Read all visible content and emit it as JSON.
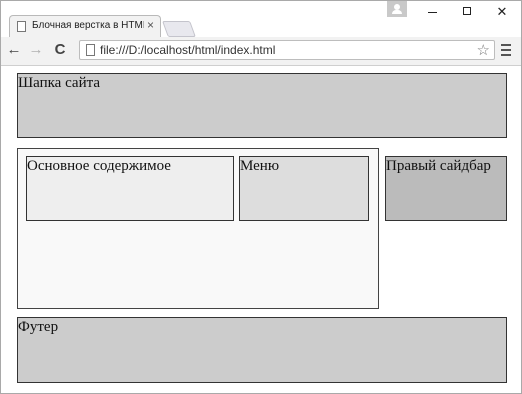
{
  "browser": {
    "tab_title": "Блочная верстка в HTML",
    "tab_close": "×",
    "address": "file:///D:/localhost/html/index.html",
    "nav": {
      "back": "←",
      "forward": "→",
      "reload": "C"
    },
    "star": "☆",
    "window_controls": {
      "close": "✕"
    }
  },
  "page": {
    "header": "Шапка сайта",
    "content": "Основное содержимое",
    "menu": "Меню",
    "sidebar": "Правый сайдбар",
    "footer": "Футер"
  },
  "colors": {
    "header_bg": "#cccccc",
    "wrapper_bg": "#f9f9f9",
    "content_bg": "#eeeeee",
    "menu_bg": "#dddddd",
    "sidebar_bg": "#bbbbbb",
    "footer_bg": "#cccccc"
  },
  "icons": [
    "page-icon",
    "tab-close-icon",
    "profile-icon",
    "minimize-icon",
    "maximize-icon",
    "close-icon",
    "back-arrow-icon",
    "forward-arrow-icon",
    "reload-icon",
    "document-icon",
    "bookmark-star-icon",
    "menu-icon"
  ]
}
